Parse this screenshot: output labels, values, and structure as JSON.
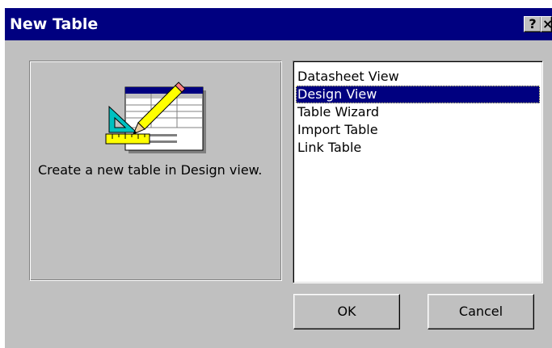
{
  "dialog": {
    "title": "New Table",
    "help_glyph": "?",
    "close_glyph": "×"
  },
  "preview": {
    "icon": "design-view-icon",
    "description": "Create a new table in Design view."
  },
  "list": {
    "items": [
      "Datasheet View",
      "Design View",
      "Table Wizard",
      "Import Table",
      "Link Table"
    ],
    "selected_index": 1
  },
  "buttons": {
    "ok_label": "OK",
    "cancel_label": "Cancel"
  },
  "colors": {
    "titlebar": "#000080",
    "face": "#c0c0c0",
    "selection": "#000080"
  }
}
